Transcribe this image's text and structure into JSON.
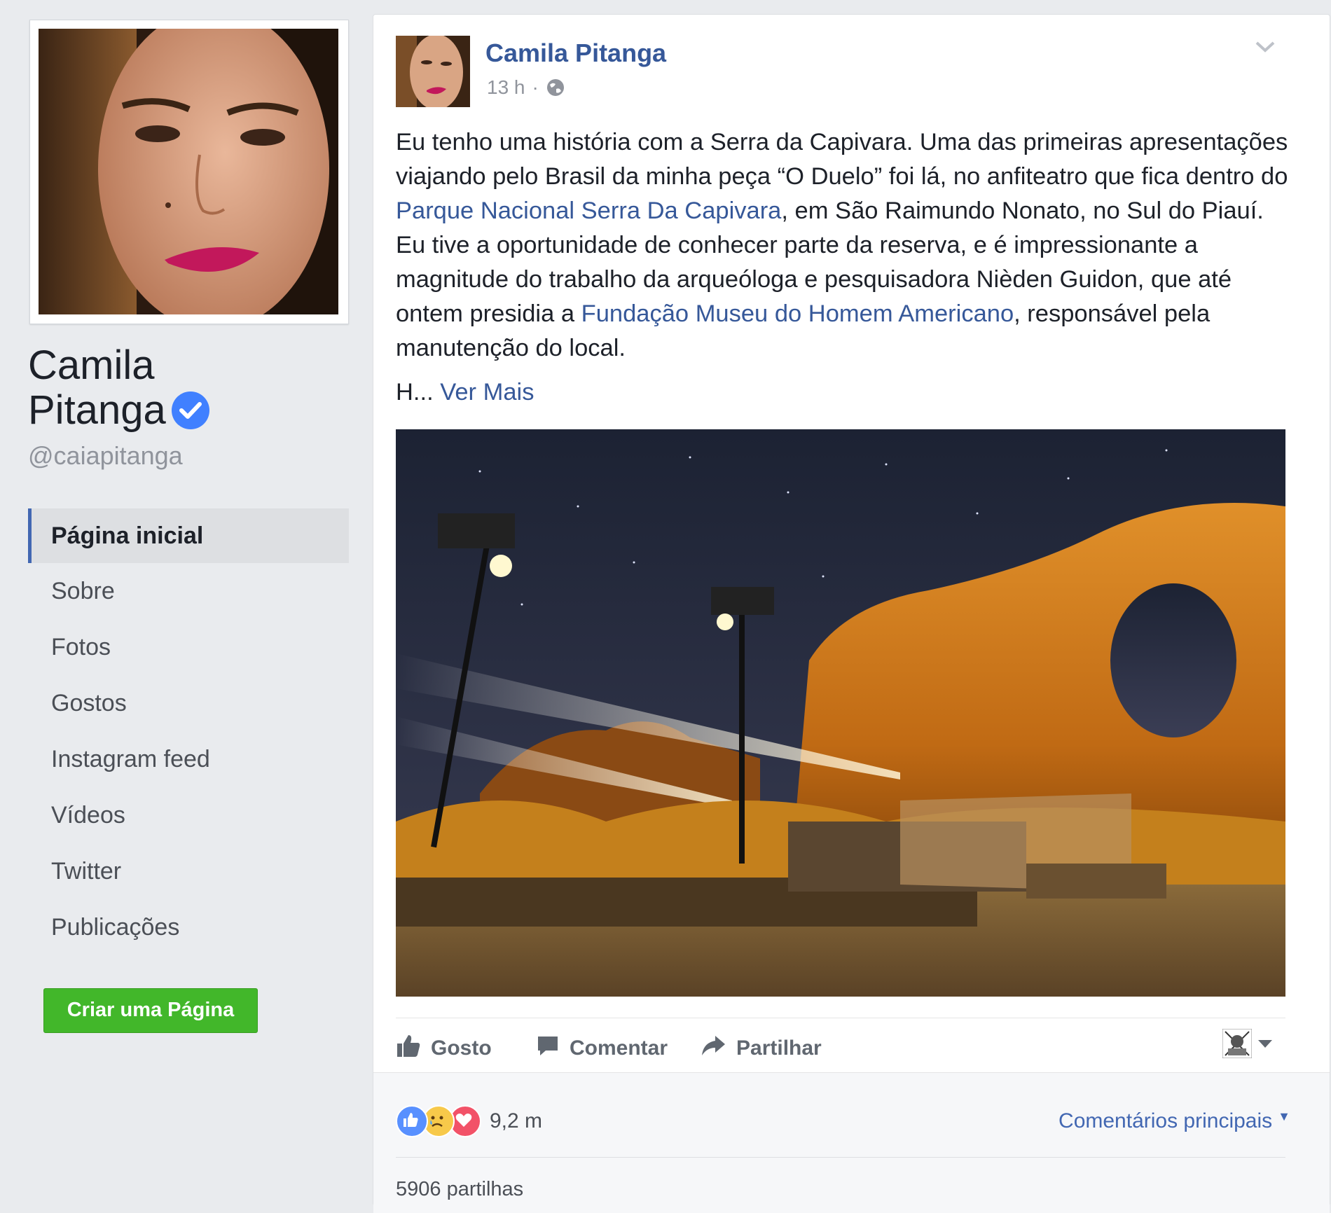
{
  "profile": {
    "name_line1": "Camila",
    "name_line2": "Pitanga",
    "handle": "@caiapitanga"
  },
  "nav": {
    "items": [
      {
        "label": "Página inicial",
        "active": true
      },
      {
        "label": "Sobre"
      },
      {
        "label": "Fotos"
      },
      {
        "label": "Gostos"
      },
      {
        "label": "Instagram feed"
      },
      {
        "label": "Vídeos"
      },
      {
        "label": "Twitter"
      },
      {
        "label": "Publicações"
      }
    ],
    "create_page_label": "Criar uma Página"
  },
  "post": {
    "author": "Camila Pitanga",
    "time": "13 h",
    "separator": "·",
    "text": {
      "part1": "Eu tenho uma história com a Serra da Capivara. Uma das primeiras apresentações viajando pelo Brasil da minha peça “O Duelo” foi lá, no anfiteatro que fica dentro do ",
      "link1": "Parque Nacional Serra Da Capivara",
      "part2": ", em São Raimundo Nonato, no Sul do Piauí. Eu tive a oportunidade de conhecer parte da reserva, e é impressionante a magnitude do trabalho da arqueóloga e pesquisadora Nièden Guidon, que até ontem presidia a ",
      "link2": "Fundação Museu do Homem Americano",
      "part3": ", responsável pela manutenção do local."
    },
    "truncated": "H...",
    "see_more": "Ver Mais",
    "actions": {
      "like": "Gosto",
      "comment": "Comentar",
      "share": "Partilhar"
    },
    "reaction_count": "9,2 m",
    "top_comments": "Comentários principais",
    "shares": "5906 partilhas"
  },
  "colors": {
    "link": "#365899",
    "accent_green": "#42b72a",
    "background": "#e9ebee",
    "verified": "#4080ff"
  },
  "icons": [
    "chevron-down-icon",
    "globe-icon",
    "verified-icon",
    "like-icon",
    "comment-icon",
    "share-icon",
    "reaction-like-icon",
    "reaction-sad-icon",
    "reaction-love-icon"
  ]
}
